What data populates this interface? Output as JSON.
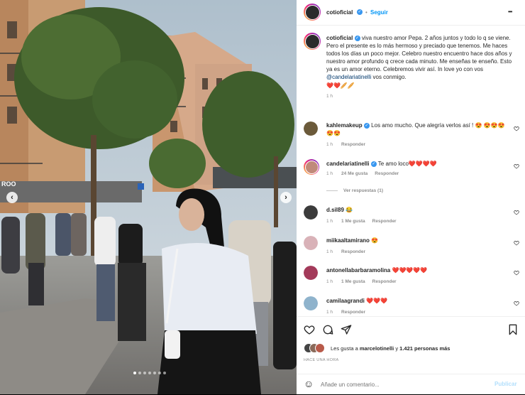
{
  "post": {
    "username": "cotioficial",
    "follow_label": "Seguir",
    "more_label": "•••",
    "caption_username": "cotioficial",
    "caption_text": "viva nuestro amor Pepa. 2 años juntos y todo lo q se viene. Pero el presente es lo más hermoso y preciado que tenemos. Me haces todos los días un poco mejor. Celebro nuestro encuentro hace dos años y nuestro amor profundo q crece cada minuto. Me enseñas te enseño. Esto ya es un amor eterno. Celebremos vivir así. In love yo con vos",
    "caption_mention": "@candelariatinelli",
    "caption_tail": "vos conmigo.",
    "caption_emojis": "❤️❤️🥖🥖",
    "caption_time": "1 h"
  },
  "comments": [
    {
      "username": "kahlemakeup",
      "verified": true,
      "text": "Los amo mucho. Que alegría verlos así ! 😍 😍😍😍😍😍",
      "time": "1 h",
      "likes": "",
      "reply": "Responder",
      "avatar_color": "#6b5a3a"
    },
    {
      "username": "candelariatinelli",
      "verified": true,
      "text": "Te amo loco❤️❤️❤️❤️",
      "time": "1 h",
      "likes": "24 Me gusta",
      "reply": "Responder",
      "avatar_color": "#c08a7a",
      "view_replies": "Ver respuestas (1)"
    },
    {
      "username": "d.sil89",
      "verified": false,
      "text": "😂",
      "time": "1 h",
      "likes": "1 Me gusta",
      "reply": "Responder",
      "avatar_color": "#3b3b3b"
    },
    {
      "username": "miikaaltamirano",
      "verified": false,
      "text": "😍",
      "time": "1 h",
      "likes": "",
      "reply": "Responder",
      "avatar_color": "#d9b2b8"
    },
    {
      "username": "antonellabarbaramolina",
      "verified": false,
      "text": "❤️❤️❤️❤️❤️",
      "time": "1 h",
      "likes": "1 Me gusta",
      "reply": "Responder",
      "avatar_color": "#a33a5a"
    },
    {
      "username": "camilaagrandi",
      "verified": false,
      "text": "❤️❤️❤️",
      "time": "1 h",
      "likes": "",
      "reply": "Responder",
      "avatar_color": "#8fb3cc"
    }
  ],
  "actions": {
    "likes_prefix": "Les gusta a",
    "likes_user": "marcelotinelli",
    "likes_mid": "y",
    "likes_count": "1.421 personas más",
    "timestamp": "HACE UNA HORA"
  },
  "add_comment": {
    "emoji_icon": "☺",
    "placeholder": "Añade un comentario...",
    "publish_label": "Publicar"
  },
  "carousel": {
    "prev": "‹",
    "next": "›",
    "total_slides": 7,
    "active_slide": 1
  },
  "overlay_text": {
    "sign_text": "ROO"
  },
  "colors": {
    "verified_blue": "#3897f0",
    "link_blue": "#00376b",
    "follow_blue": "#0095f6",
    "heart_red": "#ed4956"
  }
}
